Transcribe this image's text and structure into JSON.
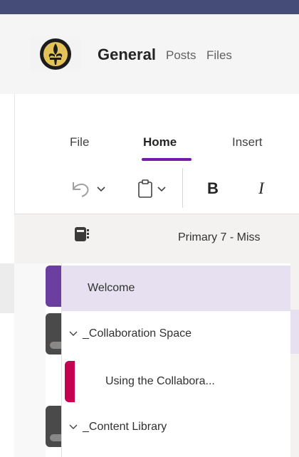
{
  "header": {
    "team_logo_icon": "fleur-de-lis-crest",
    "channel_name": "General",
    "tabs": [
      "Posts",
      "Files"
    ]
  },
  "ribbon": {
    "tabs": [
      {
        "label": "File",
        "active": false
      },
      {
        "label": "Home",
        "active": true
      },
      {
        "label": "Insert",
        "active": false
      }
    ],
    "tools": {
      "undo_icon": "undo-icon",
      "clipboard_icon": "clipboard-icon",
      "bold_label": "B",
      "italic_label": "I"
    }
  },
  "notebook": {
    "icon": "notebook-icon",
    "title": "Primary 7 - Miss"
  },
  "pages": [
    {
      "label": "Welcome",
      "selected": true,
      "collapsible": false
    },
    {
      "label": "_Collaboration Space",
      "selected": false,
      "collapsible": true,
      "expanded": true
    },
    {
      "label": "Using the Collabora...",
      "selected": false,
      "collapsible": false,
      "indent": 1
    },
    {
      "label": "_Content Library",
      "selected": false,
      "collapsible": true,
      "expanded": true
    }
  ],
  "colors": {
    "topbar": "#454c77",
    "accent": "#7719aa",
    "selected_row": "#e6e0f0",
    "section_purple": "#6b3fa0",
    "section_magenta": "#c4004f",
    "section_teal": "#00b7c3"
  }
}
